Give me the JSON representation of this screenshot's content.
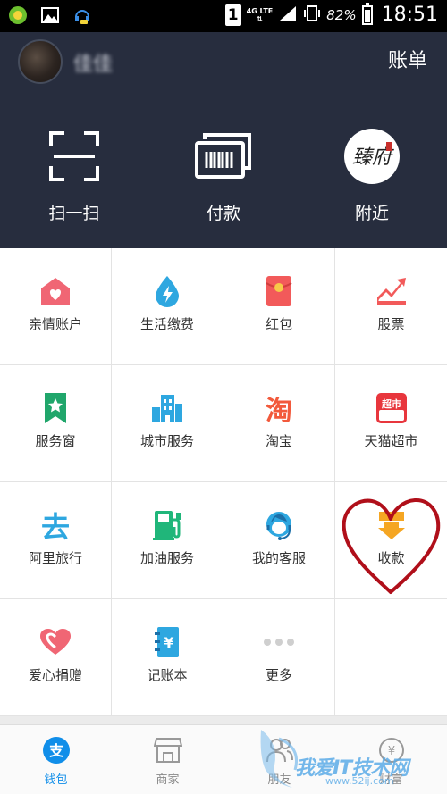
{
  "status_bar": {
    "sim": "1",
    "network": "4G LTE",
    "battery": "82%",
    "time": "18:51"
  },
  "header": {
    "username": "佳佳",
    "bill_label": "账单",
    "actions": [
      {
        "label": "扫一扫",
        "icon": "scan-icon"
      },
      {
        "label": "付款",
        "icon": "barcode-card-icon"
      },
      {
        "label": "附近",
        "icon": "nearby-seal-icon",
        "seal_text": "臻府"
      }
    ]
  },
  "grid": [
    {
      "label": "亲情账户",
      "icon": "family-house-icon",
      "color": "#f06674"
    },
    {
      "label": "生活缴费",
      "icon": "water-drop-bolt-icon",
      "color": "#2ea7e0"
    },
    {
      "label": "红包",
      "icon": "red-envelope-icon",
      "color": "#f25a5a"
    },
    {
      "label": "股票",
      "icon": "stock-chart-icon",
      "color": "#f25a5a"
    },
    {
      "label": "服务窗",
      "icon": "bookmark-star-icon",
      "color": "#20a66b"
    },
    {
      "label": "城市服务",
      "icon": "city-building-icon",
      "color": "#2ea7e0"
    },
    {
      "label": "淘宝",
      "icon": "taobao-icon",
      "color": "#f25a3c",
      "glyph": "淘"
    },
    {
      "label": "天猫超市",
      "icon": "tmall-market-icon",
      "color": "#e8363d",
      "glyph": "超市"
    },
    {
      "label": "阿里旅行",
      "icon": "ali-travel-icon",
      "color": "#2ea7e0",
      "glyph": "去"
    },
    {
      "label": "加油服务",
      "icon": "gas-pump-icon",
      "color": "#20b67a"
    },
    {
      "label": "我的客服",
      "icon": "customer-service-icon",
      "color": "#2ea7e0"
    },
    {
      "label": "收款",
      "icon": "receive-money-icon",
      "color": "#f5a623"
    },
    {
      "label": "爱心捐赠",
      "icon": "charity-heart-icon",
      "color": "#f06674"
    },
    {
      "label": "记账本",
      "icon": "account-book-icon",
      "color": "#2ea7e0",
      "glyph": "¥"
    },
    {
      "label": "更多",
      "icon": "more-dots-icon",
      "color": "#cccccc"
    },
    {
      "label": "",
      "icon": "",
      "color": ""
    }
  ],
  "tabs": [
    {
      "label": "钱包",
      "icon": "wallet-icon",
      "active": true
    },
    {
      "label": "商家",
      "icon": "store-icon",
      "active": false
    },
    {
      "label": "朋友",
      "icon": "friends-icon",
      "active": false
    },
    {
      "label": "财富",
      "icon": "wealth-icon",
      "active": false
    }
  ],
  "watermark": {
    "text": "我爱IT技术网",
    "url": "www.52ij.com"
  },
  "colors": {
    "header_bg": "#272d3e",
    "accent": "#108ee9",
    "annotation": "#b00f1a"
  }
}
